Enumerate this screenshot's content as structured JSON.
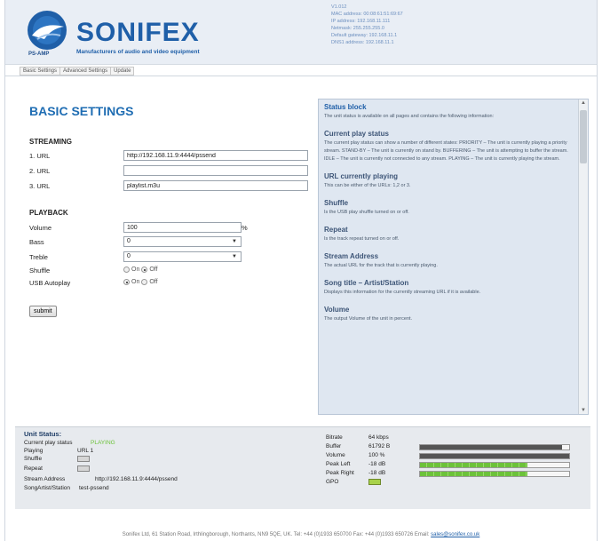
{
  "header": {
    "brand": "SONIFEX",
    "product": "PS-AMP",
    "tagline": "Manufacturers of audio and video equipment",
    "net_info": [
      "V1.012",
      "MAC address: 00:08:61:51:69:67",
      "IP address: 192.168.11.111",
      "Netmask: 255.255.255.0",
      "Default gateway: 192.168.11.1",
      "DNS1 address: 192.168.11.1"
    ]
  },
  "nav": {
    "tabs": [
      "Basic Settings",
      "Advanced Settings",
      "Update"
    ]
  },
  "form": {
    "title": "BASIC SETTINGS",
    "streaming_heading": "STREAMING",
    "url1_label": "1. URL",
    "url1_value": "http://192.168.11.9:4444/pssend",
    "url2_label": "2. URL",
    "url2_value": "",
    "url3_label": "3. URL",
    "url3_value": "playlist.m3u",
    "playback_heading": "PLAYBACK",
    "volume_label": "Volume",
    "volume_value": "100",
    "volume_unit": "%",
    "bass_label": "Bass",
    "bass_value": "0",
    "treble_label": "Treble",
    "treble_value": "0",
    "shuffle_label": "Shuffle",
    "shuffle_on": "On",
    "shuffle_off": "Off",
    "usb_label": "USB Autoplay",
    "usb_on": "On",
    "usb_off": "Off",
    "submit_label": "submit"
  },
  "info_panel": {
    "title": "Status block",
    "intro": "The unit status is available on all pages and contains the following information:",
    "sections": [
      {
        "heading": "Current play status",
        "text": "The current play status can show a number of different states: PRIORITY – The unit is currently playing a priority stream. STAND-BY – The unit is currently on stand by. BUFFERING – The unit is attempting to buffer the stream. IDLE – The unit is currently not connected to any stream. PLAYING – The unit is currently playing the stream."
      },
      {
        "heading": "URL currently playing",
        "text": "This can be either of the URLs: 1,2 or 3."
      },
      {
        "heading": "Shuffle",
        "text": "Is the USB play shuffle turned on or off."
      },
      {
        "heading": "Repeat",
        "text": "Is the track repeat turned on or off."
      },
      {
        "heading": "Stream Address",
        "text": "The actual URL for the track that is currently playing."
      },
      {
        "heading": "Song title – Artist/Station",
        "text": "Displays this information for the currently streaming URL if it is available."
      },
      {
        "heading": "Volume",
        "text": "The output Volume of the unit in percent."
      }
    ]
  },
  "unit_status": {
    "title": "Unit Status:",
    "play_status_label": "Current play status",
    "play_status_value": "PLAYING",
    "playing_label": "Playing",
    "playing_value": "URL 1",
    "shuffle_label": "Shuffle",
    "repeat_label": "Repeat",
    "stream_label": "Stream Address",
    "stream_value": "http://192.168.11.9:4444/pssend",
    "song_label": "SongArtist/Station",
    "song_value": "test-pssend",
    "bitrate_label": "Bitrate",
    "bitrate_value": "64 kbps",
    "buffer_label": "Buffer",
    "buffer_value": "61792 B",
    "buffer_level": 0.95,
    "volume_label": "Volume",
    "volume_value": "100 %",
    "volume_level": 1.0,
    "peak_left_label": "Peak Left",
    "peak_left_value": "-18 dB",
    "peak_left_level": 0.72,
    "peak_right_label": "Peak Right",
    "peak_right_value": "-18 dB",
    "peak_right_level": 0.72,
    "gpo_label": "GPO"
  },
  "footer": {
    "text": "Sonifex Ltd, 61 Station Road, Irthlingborough, Northants, NN9 5QE, UK. Tel: +44 (0)1933 650700 Fax: +44 (0)1933 650726 Email: ",
    "email": "sales@sonifex.co.uk"
  },
  "colors": {
    "brand_blue": "#1f5fa8",
    "playing_green": "#6cc23a",
    "header_bg": "#e9eef5"
  }
}
